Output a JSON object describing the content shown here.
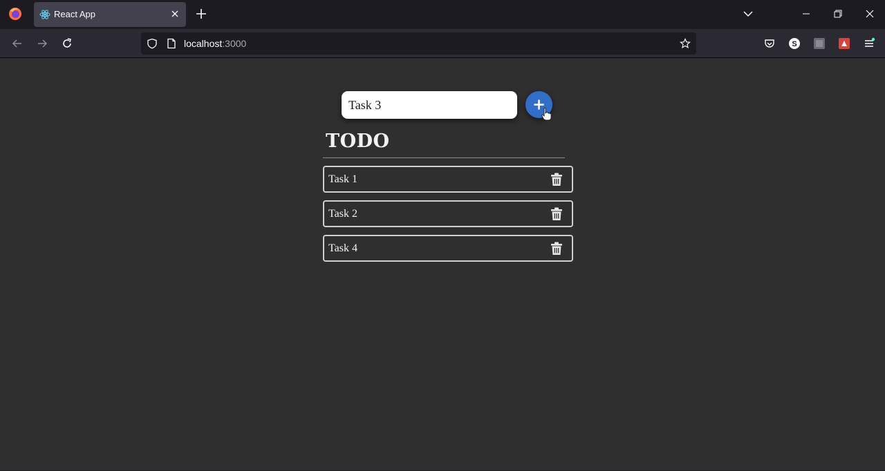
{
  "browser": {
    "tab_title": "React App",
    "url_host": "localhost",
    "url_port": ":3000"
  },
  "form": {
    "input_value": "Task 3",
    "add_button_label": "+"
  },
  "todo": {
    "title": "TODO",
    "tasks": [
      {
        "label": "Task 1"
      },
      {
        "label": "Task 2"
      },
      {
        "label": "Task 4"
      }
    ]
  },
  "colors": {
    "page_background": "#2f2f2f",
    "add_button": "#2f6fc9",
    "task_border": "#cfcfcf"
  },
  "icons": {
    "tab_favicon": "react-icon",
    "delete": "trash-icon",
    "add": "plus-icon"
  }
}
